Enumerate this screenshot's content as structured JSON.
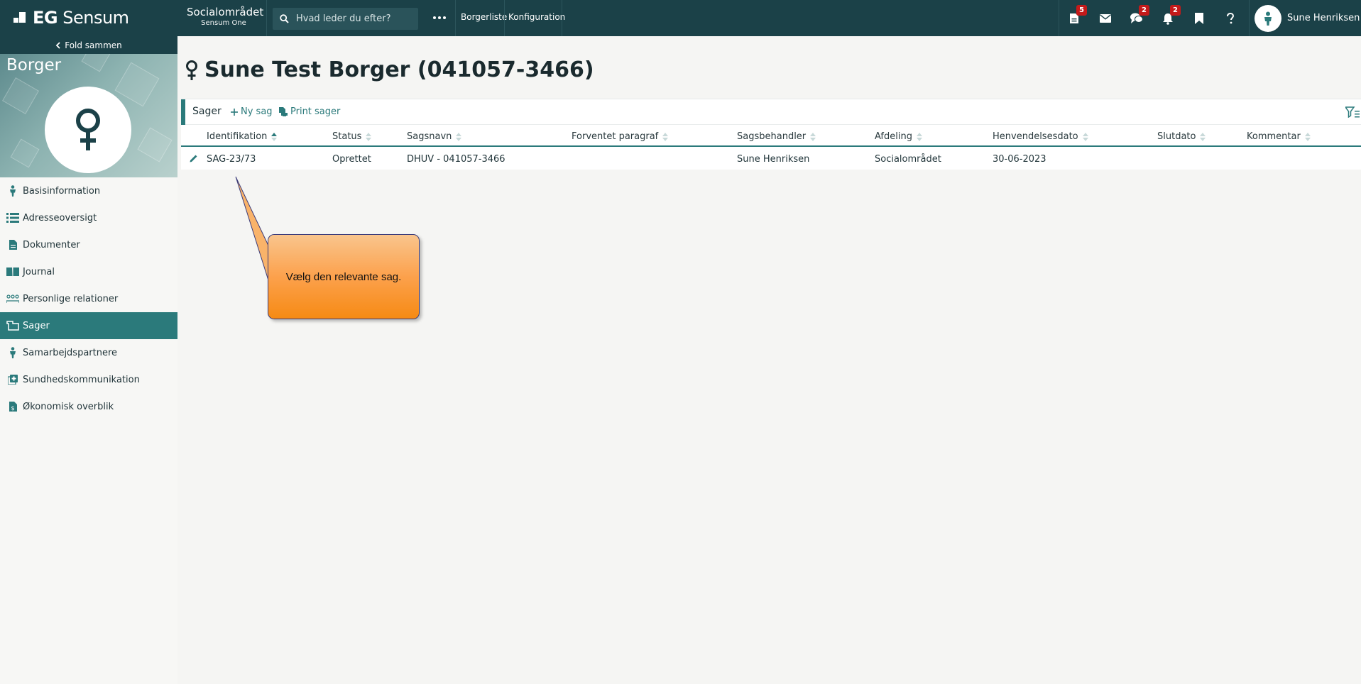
{
  "topbar": {
    "logo_bold": "EG",
    "logo_rest": "Sensum",
    "area_title": "Socialområdet",
    "area_subtitle": "Sensum One",
    "search_placeholder": "Hvad leder du efter?",
    "nav": [
      "Borgerliste",
      "Konfiguration"
    ],
    "badges": {
      "documents": "5",
      "chat": "2",
      "notifications": "2"
    },
    "user_name": "Sune Henriksen"
  },
  "sidebar": {
    "fold_label": "Fold sammen",
    "hero_title": "Borger",
    "items": [
      {
        "label": "Basisinformation",
        "icon": "person-icon"
      },
      {
        "label": "Adresseoversigt",
        "icon": "address-list-icon"
      },
      {
        "label": "Dokumenter",
        "icon": "document-icon"
      },
      {
        "label": "Journal",
        "icon": "journal-book-icon"
      },
      {
        "label": "Personlige relationer",
        "icon": "relations-icon"
      },
      {
        "label": "Sager",
        "icon": "cases-icon",
        "active": true
      },
      {
        "label": "Samarbejdspartnere",
        "icon": "partner-person-icon"
      },
      {
        "label": "Sundhedskommunikation",
        "icon": "health-communication-icon"
      },
      {
        "label": "Økonomisk overblik",
        "icon": "economy-icon"
      }
    ]
  },
  "page": {
    "title": "Sune Test Borger (041057-3466)"
  },
  "panel": {
    "title": "Sager",
    "new_case": "Ny sag",
    "print_cases": "Print sager"
  },
  "table": {
    "columns": [
      "Identifikation",
      "Status",
      "Sagsnavn",
      "Forventet paragraf",
      "Sagsbehandler",
      "Afdeling",
      "Henvendelsesdato",
      "Slutdato",
      "Kommentar"
    ],
    "sorted_column": "Identifikation",
    "rows": [
      [
        "SAG-23/73",
        "Oprettet",
        "DHUV - 041057-3466",
        "",
        "Sune Henriksen",
        "Socialområdet",
        "30-06-2023",
        "",
        ""
      ]
    ]
  },
  "callout": {
    "text": "Vælg den relevante sag."
  },
  "colors": {
    "topbar": "#1b4148",
    "accent": "#2b7a7b",
    "badge": "#c41a1a",
    "callout": "#fca14c"
  }
}
